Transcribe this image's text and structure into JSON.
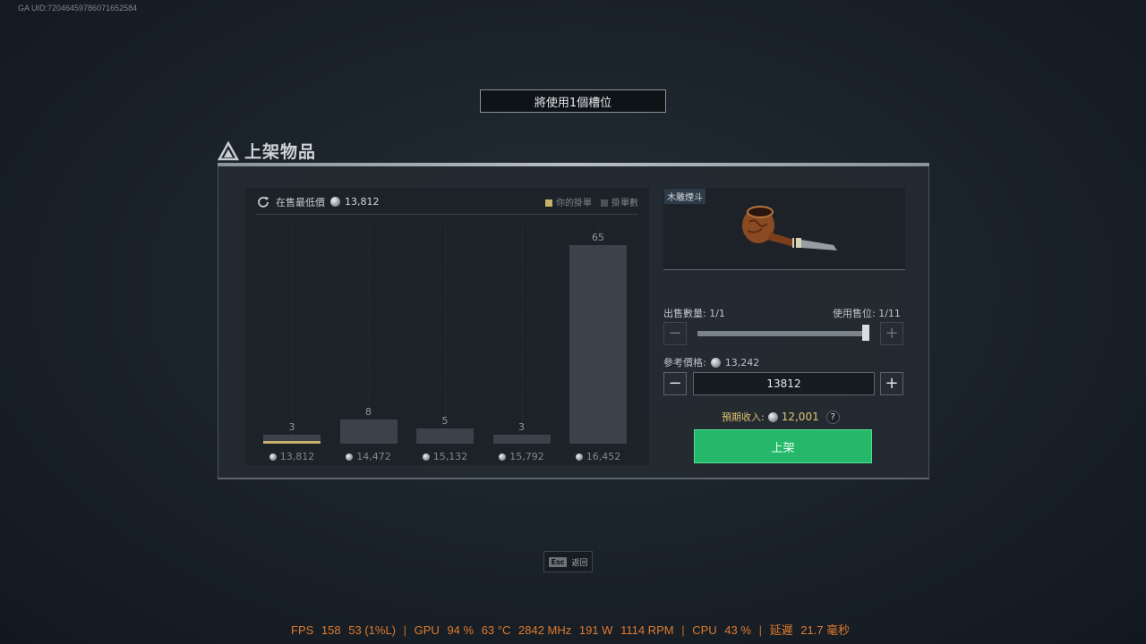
{
  "uid": "GA UID:72046459786071652584",
  "slot_banner": "將使用1個槽位",
  "title": "上架物品",
  "chart": {
    "header_label": "在售最低價",
    "lowest_price": "13,812",
    "legend_mine": "你的掛單",
    "legend_all": "掛單數"
  },
  "chart_data": {
    "type": "bar",
    "categories": [
      "13,812",
      "14,472",
      "15,132",
      "15,792",
      "16,452"
    ],
    "values": [
      3,
      8,
      5,
      3,
      65
    ],
    "mine": [
      1,
      0,
      0,
      0,
      0
    ],
    "ylim": [
      0,
      65
    ]
  },
  "item": {
    "name": "木雕煙斗"
  },
  "sell_qty_label": "出售數量: 1/1",
  "slots_label": "使用售位: 1/11",
  "slider_level": 1.0,
  "ref_price_label": "參考價格:",
  "ref_price": "13,242",
  "price_input": "13812",
  "income_label": "預期收入:",
  "income_value": "12,001",
  "help_glyph": "?",
  "list_button": "上架",
  "minus_glyph": "−",
  "plus_glyph": "+",
  "esc": {
    "key": "Esc",
    "label": "返回"
  },
  "osd": {
    "fps_label": "FPS",
    "fps": "158",
    "fps_low": "53 (1%L)",
    "gpu_label": "GPU",
    "gpu_load": "94 %",
    "gpu_temp": "63 °C",
    "gpu_clock": "2842 MHz",
    "gpu_power": "191 W",
    "gpu_fan": "1114 RPM",
    "cpu_label": "CPU",
    "cpu_load": "43 %",
    "latency_label": "延遲",
    "latency": "21.7 毫秒",
    "sep": "|"
  },
  "colors": {
    "accent_green": "#26b86a",
    "mine_gold": "#c7b06a",
    "osd_orange": "#e07a2c"
  }
}
